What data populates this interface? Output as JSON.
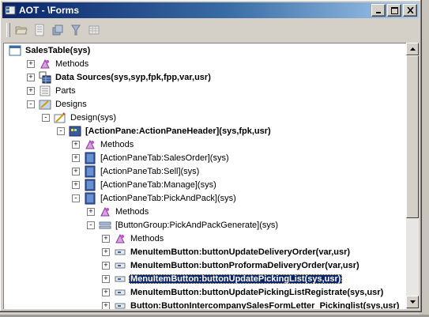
{
  "window": {
    "title": "AOT - \\Forms",
    "minimize": "_",
    "maximize": "□",
    "close": "✕"
  },
  "toolbar": {
    "buttons": [
      "open-icon",
      "properties-icon",
      "compile-icon",
      "filter-icon",
      "grid-icon"
    ]
  },
  "tree": {
    "nodes": [
      {
        "label": "SalesTable(sys)",
        "bold": true,
        "icon": "form-icon",
        "expander": ""
      },
      {
        "label": "Methods",
        "bold": false,
        "icon": "methods-icon",
        "expander": "+"
      },
      {
        "label": "Data Sources(sys,syp,fpk,fpp,var,usr)",
        "bold": true,
        "icon": "datasource-icon",
        "expander": "+"
      },
      {
        "label": "Parts",
        "bold": false,
        "icon": "parts-icon",
        "expander": "+"
      },
      {
        "label": "Designs",
        "bold": false,
        "icon": "designs-icon",
        "expander": "−"
      },
      {
        "label": "Design(sys)",
        "bold": false,
        "icon": "design-icon",
        "expander": "−"
      },
      {
        "label": "[ActionPane:ActionPaneHeader](sys,fpk,usr)",
        "bold": true,
        "icon": "actionpane-icon",
        "expander": "−"
      },
      {
        "label": "Methods",
        "bold": false,
        "icon": "methods-icon",
        "expander": "+"
      },
      {
        "label": "[ActionPaneTab:SalesOrder](sys)",
        "bold": false,
        "icon": "tab-icon",
        "expander": "+"
      },
      {
        "label": "[ActionPaneTab:Sell](sys)",
        "bold": false,
        "icon": "tab-icon",
        "expander": "+"
      },
      {
        "label": "[ActionPaneTab:Manage](sys)",
        "bold": false,
        "icon": "tab-icon",
        "expander": "+"
      },
      {
        "label": "[ActionPaneTab:PickAndPack](sys)",
        "bold": false,
        "icon": "tab-icon",
        "expander": "−"
      },
      {
        "label": "Methods",
        "bold": false,
        "icon": "methods-icon",
        "expander": "+"
      },
      {
        "label": "[ButtonGroup:PickAndPackGenerate](sys)",
        "bold": false,
        "icon": "buttongroup-icon",
        "expander": "−"
      },
      {
        "label": "Methods",
        "bold": false,
        "icon": "methods-icon",
        "expander": "+"
      },
      {
        "label": "MenuItemButton:buttonUpdateDeliveryOrder(var,usr)",
        "bold": true,
        "icon": "menuitembutton-icon",
        "expander": "+"
      },
      {
        "label": "MenuItemButton:buttonProformaDeliveryOrder(var,usr)",
        "bold": true,
        "icon": "menuitembutton-icon",
        "expander": "+"
      },
      {
        "label": "MenuItemButton:buttonUpdatePickingList(sys,usr)",
        "bold": true,
        "icon": "menuitembutton-icon",
        "expander": "+",
        "selected": true
      },
      {
        "label": "MenuItemButton:buttonUpdatePickingListRegistrate(sys,usr)",
        "bold": true,
        "icon": "menuitembutton-icon",
        "expander": "+"
      },
      {
        "label": "Button:ButtonIntercompanySalesFormLetter_Pickinglist(sys,usr)",
        "bold": true,
        "icon": "menuitembutton-icon",
        "expander": "+"
      }
    ]
  }
}
